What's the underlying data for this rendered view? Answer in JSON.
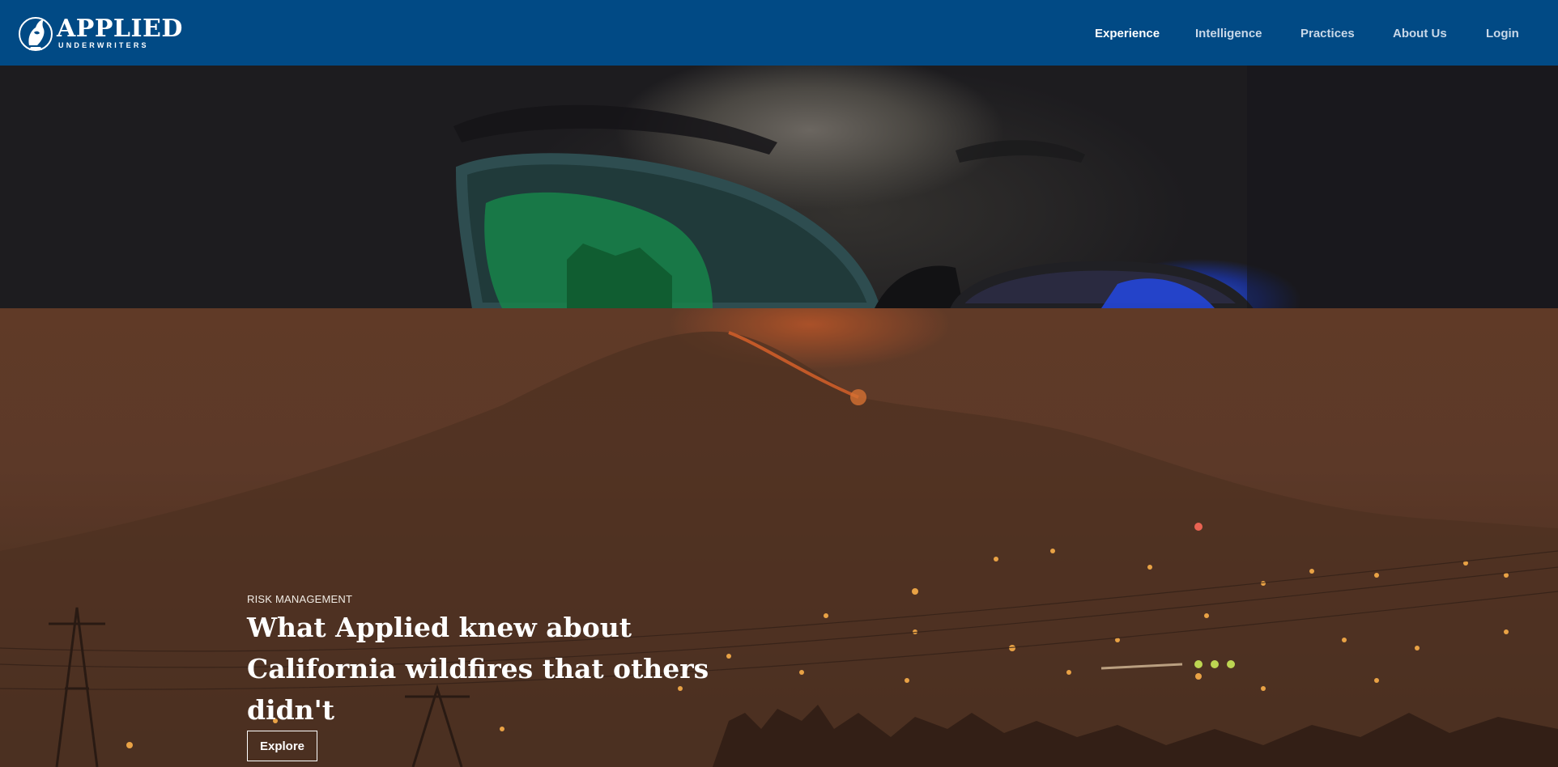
{
  "brand": {
    "name": "APPLIED",
    "tagline": "UNDERWRITERS",
    "logo_icon": "applied-underwriters-logo-icon"
  },
  "nav": {
    "items": [
      {
        "label": "Experience",
        "active": true
      },
      {
        "label": "Intelligence",
        "active": false
      },
      {
        "label": "Practices",
        "active": false
      },
      {
        "label": "About Us",
        "active": false
      },
      {
        "label": "Login",
        "active": false
      }
    ]
  },
  "hero_top": {
    "image": "close-up-eye-with-glasses-reflecting-screen"
  },
  "hero_feature": {
    "image": "wildfire-on-hillside-over-town-at-night",
    "kicker": "RISK MANAGEMENT",
    "headline": "What Applied knew about California wildfires that others didn't",
    "cta_label": "Explore"
  },
  "colors": {
    "nav_background": "#014a85",
    "nav_active": "#ffffff",
    "nav_inactive": "#c9d8e8",
    "hero_overlay": "#5a3928"
  }
}
